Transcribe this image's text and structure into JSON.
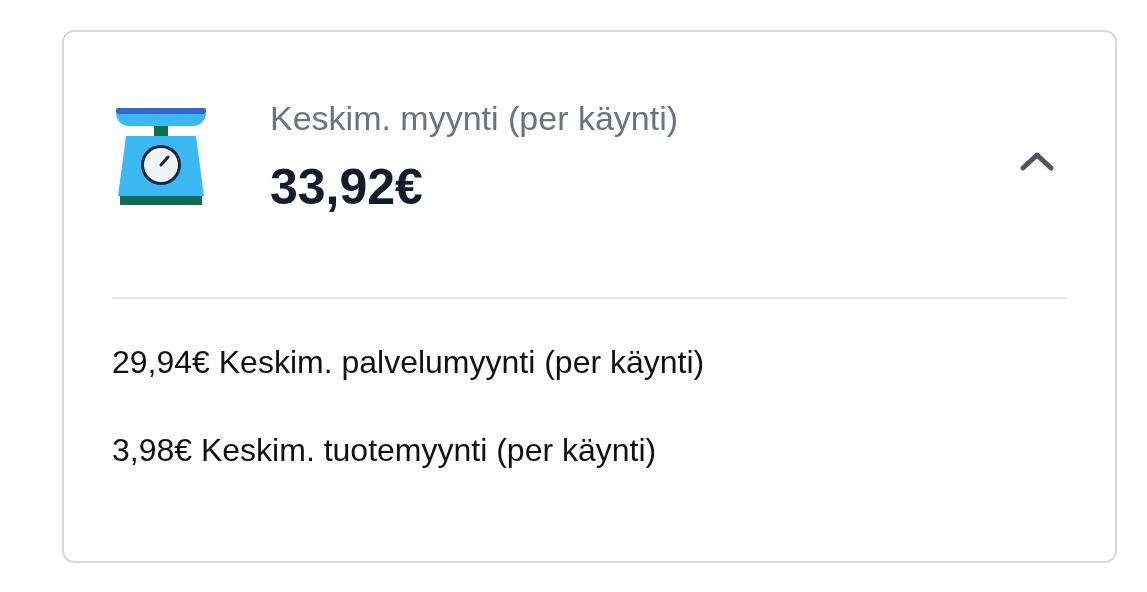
{
  "card": {
    "title": "Keskim. myynti (per käynti)",
    "value": "33,92€",
    "expanded": true,
    "details": [
      "29,94€ Keskim. palvelumyynti (per käynti)",
      "3,98€ Keskim. tuotemyynti (per käynti)"
    ]
  }
}
